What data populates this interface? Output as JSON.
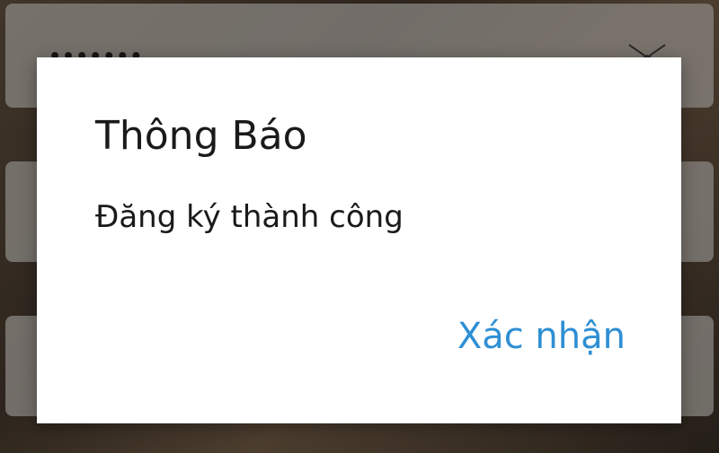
{
  "background": {
    "password_mask": "•••••••",
    "clear_icon": "close-icon"
  },
  "dialog": {
    "title": "Thông Báo",
    "message": "Đăng ký thành công",
    "confirm_label": "Xác nhận"
  },
  "colors": {
    "accent": "#2f8fd4",
    "dialog_bg": "#ffffff",
    "text": "#1a1a1a"
  }
}
